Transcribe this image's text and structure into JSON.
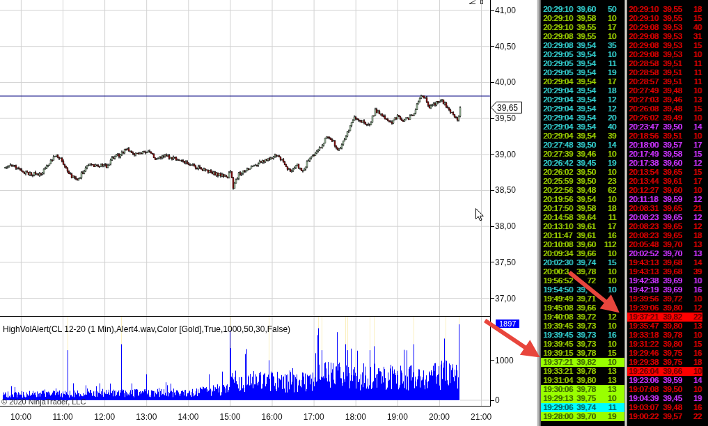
{
  "price_chart": {
    "axis_labels": [
      "41,00",
      "40,50",
      "40,00",
      "39,50",
      "39,00",
      "38,50",
      "38,00",
      "37,50",
      "37,00"
    ],
    "last_price": "39,65"
  },
  "indicator": {
    "title": "HighVolAlert(CL 12-20 (1 Min),Alert4.wav,Color [Gold],True,1000,50,30,False)",
    "current_value": "1897",
    "axis_labels": [
      "1000",
      "0"
    ],
    "copyright": "© 2020 NinjaTrader, LLC"
  },
  "time_axis": {
    "labels": [
      "10:00",
      "11:00",
      "12:00",
      "13:00",
      "14:00",
      "15:00",
      "16:00",
      "17:00",
      "18:00",
      "19:00",
      "20:00",
      "21:00"
    ]
  },
  "left_tape": {
    "rows": [
      {
        "time": "20:29:10",
        "price": "39,60",
        "size": "50",
        "color": "#33cccc",
        "highlighted": false
      },
      {
        "time": "20:29:10",
        "price": "39,58",
        "size": "10",
        "color": "#99cc00",
        "highlighted": false
      },
      {
        "time": "20:29:10",
        "price": "39,55",
        "size": "17",
        "color": "#99cc00",
        "highlighted": false
      },
      {
        "time": "20:29:08",
        "price": "39,55",
        "size": "10",
        "color": "#99cc00",
        "highlighted": false
      },
      {
        "time": "20:29:08",
        "price": "39,54",
        "size": "35",
        "color": "#33cccc",
        "highlighted": false
      },
      {
        "time": "20:29:05",
        "price": "39,54",
        "size": "10",
        "color": "#33cccc",
        "highlighted": false
      },
      {
        "time": "20:29:05",
        "price": "39,54",
        "size": "11",
        "color": "#33cccc",
        "highlighted": false
      },
      {
        "time": "20:29:05",
        "price": "39,54",
        "size": "19",
        "color": "#33cccc",
        "highlighted": false
      },
      {
        "time": "20:29:04",
        "price": "39,54",
        "size": "17",
        "color": "#99cc00",
        "highlighted": false
      },
      {
        "time": "20:29:04",
        "price": "39,54",
        "size": "18",
        "color": "#33cccc",
        "highlighted": false
      },
      {
        "time": "20:29:04",
        "price": "39,54",
        "size": "12",
        "color": "#33cccc",
        "highlighted": false
      },
      {
        "time": "20:29:04",
        "price": "39,54",
        "size": "12",
        "color": "#33cccc",
        "highlighted": false
      },
      {
        "time": "20:29:04",
        "price": "39,54",
        "size": "20",
        "color": "#33cccc",
        "highlighted": false
      },
      {
        "time": "20:29:04",
        "price": "39,54",
        "size": "40",
        "color": "#33cccc",
        "highlighted": false
      },
      {
        "time": "20:29:04",
        "price": "39,54",
        "size": "39",
        "color": "#99cc00",
        "highlighted": false
      },
      {
        "time": "20:27:48",
        "price": "39,50",
        "size": "14",
        "color": "#33cccc",
        "highlighted": false
      },
      {
        "time": "20:27:39",
        "price": "39,46",
        "size": "10",
        "color": "#99cc00",
        "highlighted": false
      },
      {
        "time": "20:26:42",
        "price": "39,45",
        "size": "19",
        "color": "#33cccc",
        "highlighted": false
      },
      {
        "time": "20:26:02",
        "price": "39,50",
        "size": "10",
        "color": "#99cc00",
        "highlighted": false
      },
      {
        "time": "20:25:59",
        "price": "39,50",
        "size": "23",
        "color": "#99cc00",
        "highlighted": false
      },
      {
        "time": "20:22:56",
        "price": "39,48",
        "size": "62",
        "color": "#99cc00",
        "highlighted": false
      },
      {
        "time": "20:19:56",
        "price": "39,54",
        "size": "10",
        "color": "#99cc00",
        "highlighted": false
      },
      {
        "time": "20:17:50",
        "price": "39,58",
        "size": "18",
        "color": "#99cc00",
        "highlighted": false
      },
      {
        "time": "20:14:58",
        "price": "39,64",
        "size": "11",
        "color": "#99cc00",
        "highlighted": false
      },
      {
        "time": "20:13:10",
        "price": "39,61",
        "size": "17",
        "color": "#99cc00",
        "highlighted": false
      },
      {
        "time": "20:11:47",
        "price": "39,61",
        "size": "16",
        "color": "#99cc00",
        "highlighted": false
      },
      {
        "time": "20:10:08",
        "price": "39,60",
        "size": "112",
        "color": "#99cc00",
        "highlighted": false
      },
      {
        "time": "20:09:34",
        "price": "39,66",
        "size": "10",
        "color": "#99cc00",
        "highlighted": false
      },
      {
        "time": "20:02:30",
        "price": "39,74",
        "size": "15",
        "color": "#33cccc",
        "highlighted": false
      },
      {
        "time": "20:00:3",
        "price": "39,78",
        "size": "10",
        "color": "#99cc00",
        "highlighted": false
      },
      {
        "time": "19:56:52",
        "price_end": "72",
        "size": "10",
        "color": "#99cc00",
        "highlighted": false
      },
      {
        "time": "19:54:50",
        "price": "39,",
        "size": "10",
        "color": "#33cccc",
        "highlighted": false
      },
      {
        "time": "19:49:49",
        "price": "39,71",
        "color": "#99cc00",
        "highlighted": false
      },
      {
        "time": "19:45:08",
        "price": "39,66",
        "color": "#99cc00",
        "highlighted": false
      },
      {
        "time": "19:40:08",
        "price": "39,72",
        "size": "12",
        "color": "#99cc00",
        "highlighted": false
      },
      {
        "time": "19:39:45",
        "price": "39,73",
        "size": "10",
        "color": "#99cc00",
        "highlighted": false
      },
      {
        "time": "19:39:45",
        "price": "39,73",
        "size": "16",
        "color": "#33cccc",
        "highlighted": false
      },
      {
        "time": "19:39:45",
        "price": "39,73",
        "size": "10",
        "color": "#99cc00",
        "highlighted": false
      },
      {
        "time": "19:39:15",
        "price": "39,78",
        "size": "15",
        "color": "#99cc00",
        "highlighted": false
      },
      {
        "time": "19:37:21",
        "price": "39,82",
        "size": "10",
        "color": "#99ff00",
        "highlighted": true
      },
      {
        "time": "19:33:21",
        "price": "39,78",
        "size": "13",
        "color": "#99cc00",
        "highlighted": false
      },
      {
        "time": "19:31:04",
        "price": "39,80",
        "size": "13",
        "color": "#99cc00",
        "highlighted": false
      },
      {
        "time": "19:30:06",
        "price": "39,78",
        "size": "13",
        "color": "#99ff00",
        "highlighted": true
      },
      {
        "time": "19:29:13",
        "price": "39,75",
        "size": "10",
        "color": "#99ff00",
        "highlighted": true
      },
      {
        "time": "19:29:06",
        "price": "39,74",
        "size": "11",
        "color": "#00ffff",
        "highlighted": true
      },
      {
        "time": "19:28:00",
        "price": "39,70",
        "size": "19",
        "color": "#99ff00",
        "highlighted": true
      }
    ]
  },
  "right_tape": {
    "rows": [
      {
        "time": "20:29:10",
        "price": "39,55",
        "size": "18",
        "color": "#dd0000",
        "highlighted": false
      },
      {
        "time": "20:29:10",
        "price": "39,55",
        "size": "15",
        "color": "#dd0000",
        "highlighted": false
      },
      {
        "time": "20:29:08",
        "price": "39,53",
        "size": "40",
        "color": "#dd0000",
        "highlighted": false
      },
      {
        "time": "20:29:08",
        "price": "39,53",
        "size": "31",
        "color": "#dd0000",
        "highlighted": false
      },
      {
        "time": "20:29:08",
        "price": "39,53",
        "size": "15",
        "color": "#dd0000",
        "highlighted": false
      },
      {
        "time": "20:29:08",
        "price": "39,53",
        "size": "10",
        "color": "#dd0000",
        "highlighted": false
      },
      {
        "time": "20:28:58",
        "price": "39,51",
        "size": "11",
        "color": "#dd0000",
        "highlighted": false
      },
      {
        "time": "20:28:58",
        "price": "39,51",
        "size": "11",
        "color": "#dd0000",
        "highlighted": false
      },
      {
        "time": "20:28:57",
        "price": "39,51",
        "size": "11",
        "color": "#dd0000",
        "highlighted": false
      },
      {
        "time": "20:27:49",
        "price": "39,48",
        "size": "10",
        "color": "#dd0000",
        "highlighted": false
      },
      {
        "time": "20:27:03",
        "price": "39,46",
        "size": "13",
        "color": "#dd0000",
        "highlighted": false
      },
      {
        "time": "20:26:08",
        "price": "39,48",
        "size": "15",
        "color": "#dd0000",
        "highlighted": false
      },
      {
        "time": "20:26:02",
        "price": "39,49",
        "size": "10",
        "color": "#dd0000",
        "highlighted": false
      },
      {
        "time": "20:23:47",
        "price": "39,50",
        "size": "14",
        "color": "#cc33ff",
        "highlighted": false
      },
      {
        "time": "20:18:56",
        "price": "39,51",
        "size": "10",
        "color": "#dd0000",
        "highlighted": false
      },
      {
        "time": "20:18:00",
        "price": "39,57",
        "size": "17",
        "color": "#cc33ff",
        "highlighted": false
      },
      {
        "time": "20:17:49",
        "price": "39,58",
        "size": "15",
        "color": "#cc33ff",
        "highlighted": false
      },
      {
        "time": "20:17:38",
        "price": "39,60",
        "size": "12",
        "color": "#cc33ff",
        "highlighted": false
      },
      {
        "time": "20:13:54",
        "price": "39,65",
        "size": "15",
        "color": "#dd0000",
        "highlighted": false
      },
      {
        "time": "20:13:44",
        "price": "39,61",
        "size": "17",
        "color": "#dd0000",
        "highlighted": false
      },
      {
        "time": "20:12:27",
        "price": "39,60",
        "size": "10",
        "color": "#dd0000",
        "highlighted": false
      },
      {
        "time": "20:11:18",
        "price": "39,59",
        "size": "12",
        "color": "#cc33ff",
        "highlighted": false
      },
      {
        "time": "20:08:31",
        "price": "39,65",
        "size": "21",
        "color": "#dd0000",
        "highlighted": false
      },
      {
        "time": "20:08:23",
        "price": "39,65",
        "size": "12",
        "color": "#cc33ff",
        "highlighted": false
      },
      {
        "time": "20:08:23",
        "price": "39,65",
        "size": "12",
        "color": "#dd0000",
        "highlighted": false
      },
      {
        "time": "20:08:23",
        "price": "39,65",
        "size": "18",
        "color": "#dd0000",
        "highlighted": false
      },
      {
        "time": "20:05:48",
        "price": "39,70",
        "size": "13",
        "color": "#dd0000",
        "highlighted": false
      },
      {
        "time": "20:02:52",
        "price": "39,70",
        "size": "13",
        "color": "#cc33ff",
        "highlighted": false
      },
      {
        "time": "19:43:13",
        "price": "39,68",
        "size": "14",
        "color": "#dd0000",
        "highlighted": false
      },
      {
        "time": "19:43:13",
        "price": "39,68",
        "size": "39",
        "color": "#dd0000",
        "highlighted": false
      },
      {
        "time": "19:42:38",
        "price": "39,69",
        "size": "10",
        "color": "#cc33ff",
        "highlighted": false
      },
      {
        "time": "19:42:19",
        "price": "39,69",
        "size": "16",
        "color": "#cc33ff",
        "highlighted": false
      },
      {
        "time": "19:39:56",
        "price": "39,72",
        "size": "10",
        "color": "#dd0000",
        "highlighted": false
      },
      {
        "time": "19:39:06",
        "price": "39,80",
        "size": "12",
        "color": "#dd0000",
        "highlighted": false
      },
      {
        "time": "19:37:21",
        "price": "39,82",
        "size": "22",
        "color": "#ff0000",
        "highlighted": true
      },
      {
        "time": "19:35:47",
        "price": "39,80",
        "size": "13",
        "color": "#dd0000",
        "highlighted": false
      },
      {
        "time": "19:33:18",
        "price": "39,78",
        "size": "10",
        "color": "#dd0000",
        "highlighted": false
      },
      {
        "time": "19:31:22",
        "price": "39,80",
        "size": "15",
        "color": "#dd0000",
        "highlighted": false
      },
      {
        "time": "19:29:46",
        "price": "39,75",
        "size": "16",
        "color": "#dd0000",
        "highlighted": false
      },
      {
        "time": "19:29:38",
        "price": "39,75",
        "size": "18",
        "color": "#dd0000",
        "highlighted": false
      },
      {
        "time": "19:26:04",
        "price": "39,66",
        "size": "10",
        "color": "#ff0000",
        "highlighted": true
      },
      {
        "time": "19:23:06",
        "price": "39,59",
        "size": "14",
        "color": "#cc33ff",
        "highlighted": false
      },
      {
        "time": "19:07:08",
        "price": "39,50",
        "size": "10",
        "color": "#dd0000",
        "highlighted": false
      },
      {
        "time": "19:04:39",
        "price": "39,45",
        "size": "19",
        "color": "#cc33ff",
        "highlighted": false
      },
      {
        "time": "19:03:07",
        "price": "39,48",
        "size": "16",
        "color": "#dd0000",
        "highlighted": false
      },
      {
        "time": "19:00:22",
        "price": "39,57",
        "size": "22",
        "color": "#dd0000",
        "highlighted": false
      }
    ]
  }
}
